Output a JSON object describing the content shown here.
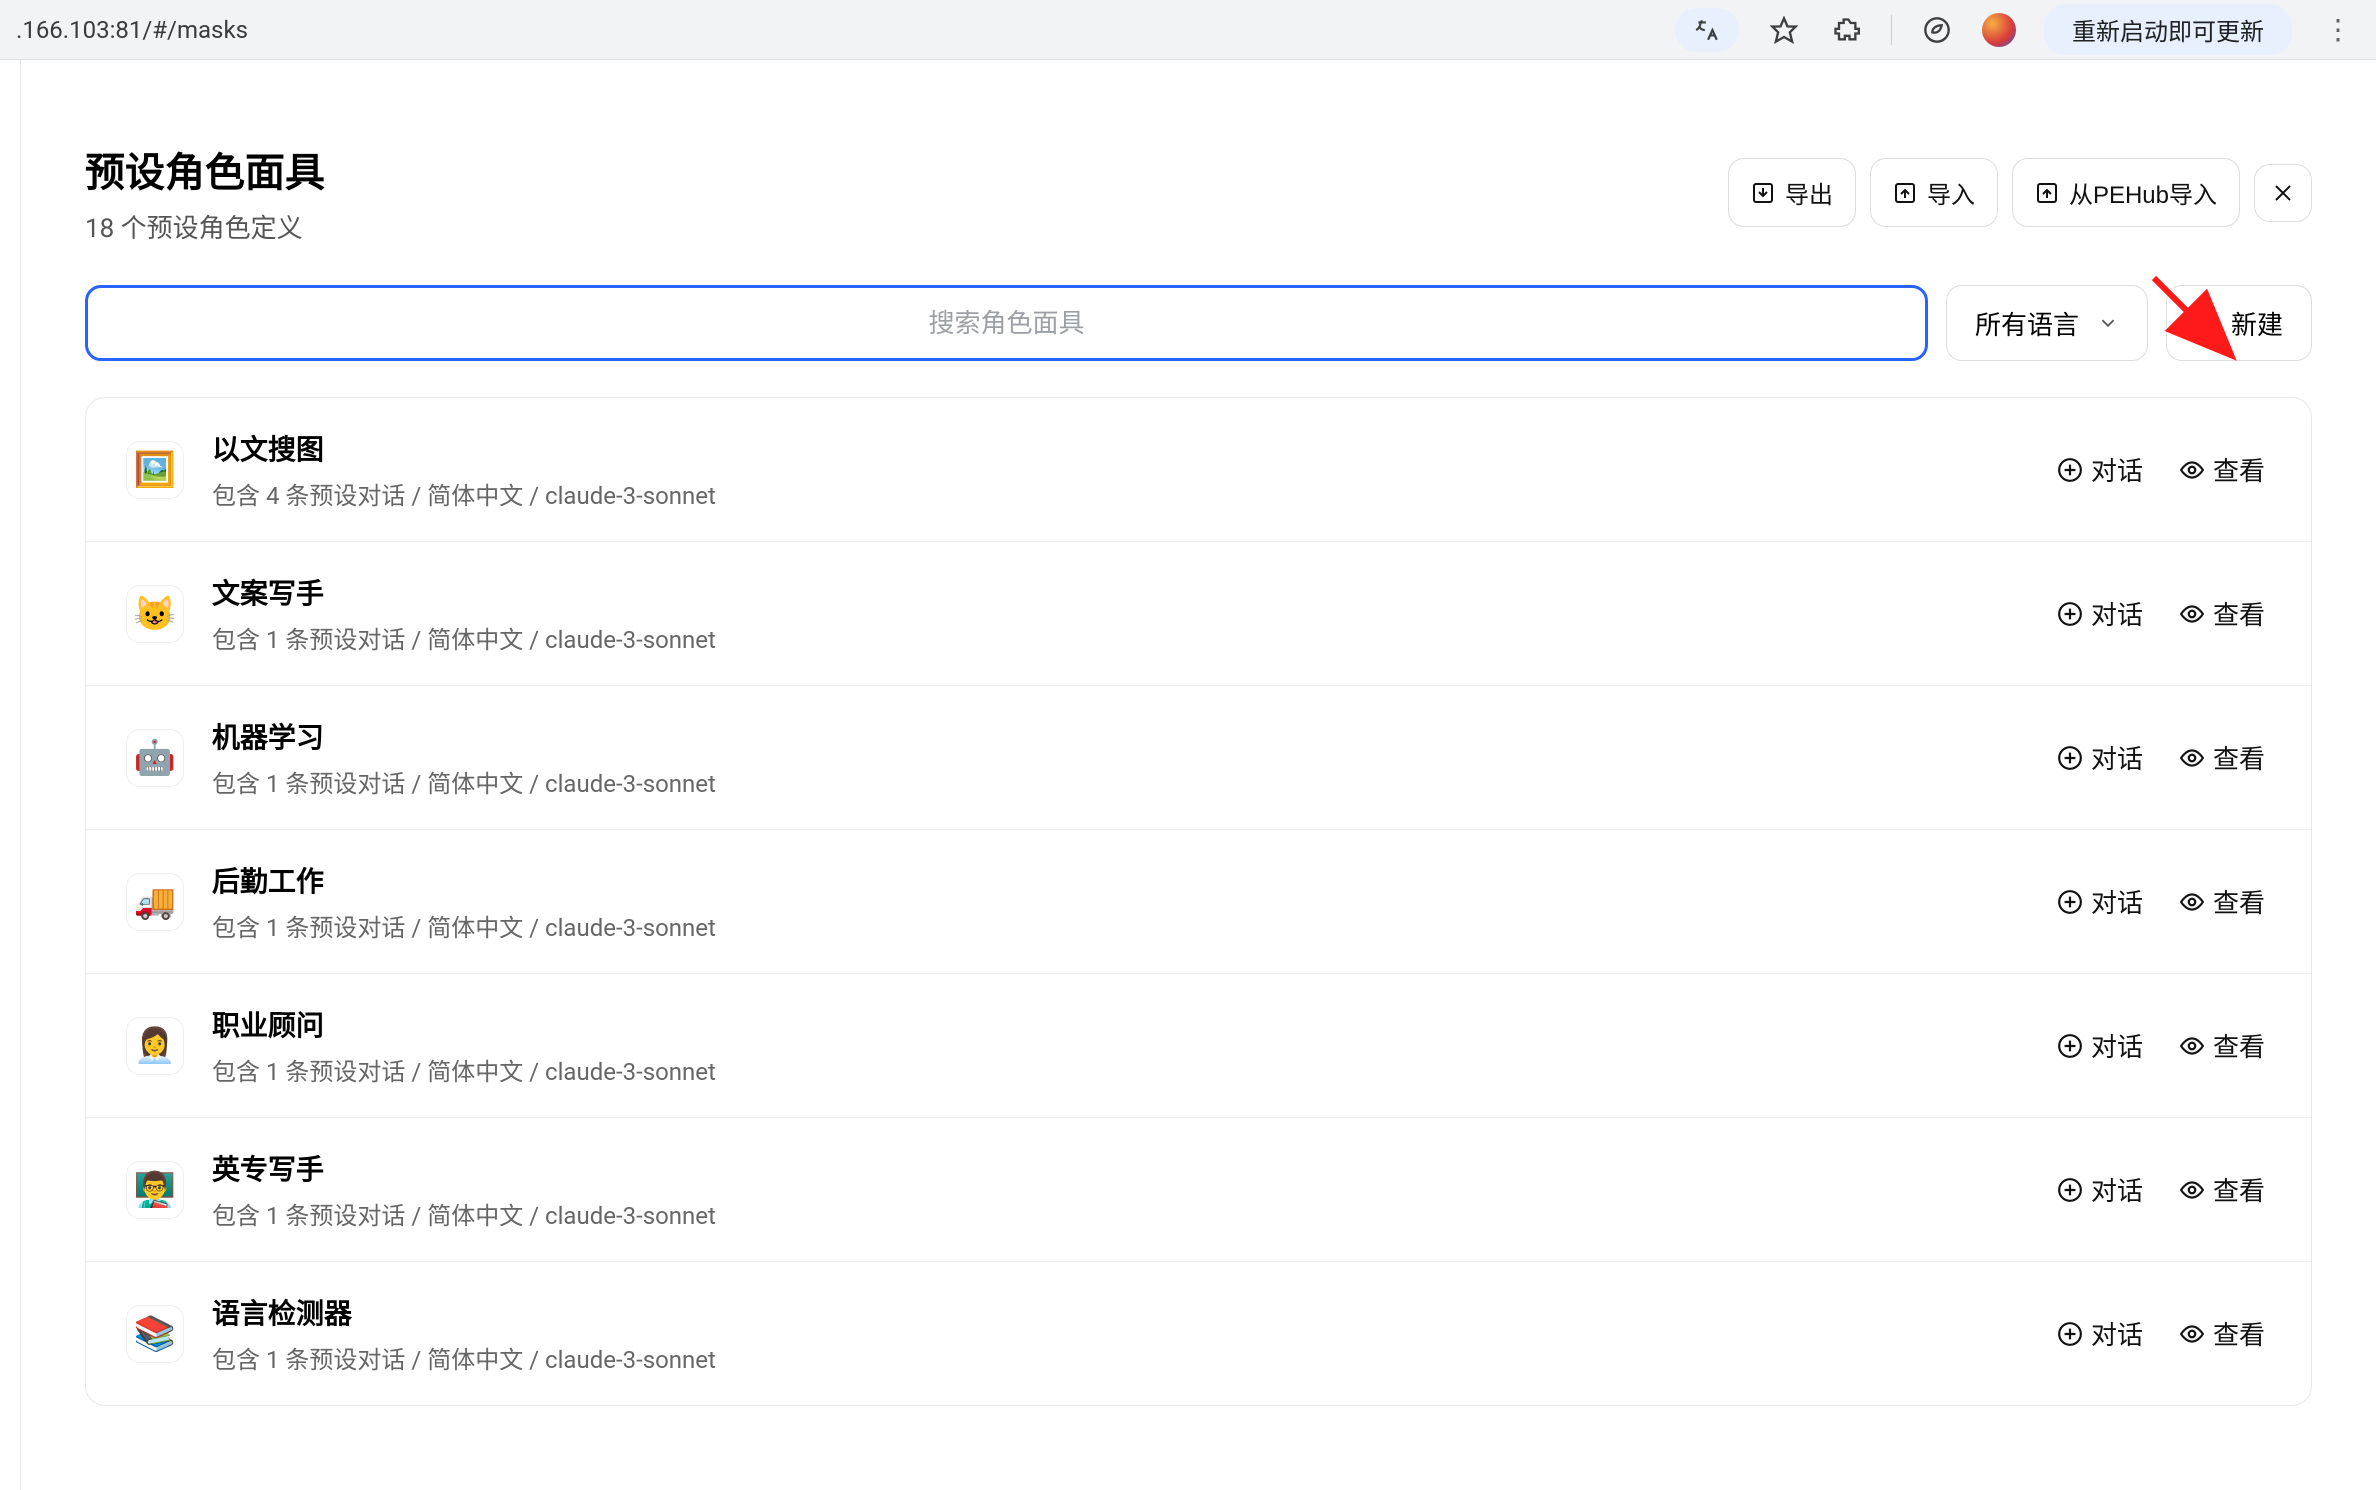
{
  "browser": {
    "url": ".166.103:81/#/masks",
    "update_label": "重新启动即可更新"
  },
  "header": {
    "title": "预设角色面具",
    "subtitle": "18 个预设角色定义",
    "export_label": "导出",
    "import_label": "导入",
    "import_pehub_label": "从PEHub导入"
  },
  "toolbar": {
    "search_placeholder": "搜索角色面具",
    "lang_label": "所有语言",
    "new_label": "新建"
  },
  "row_action": {
    "chat": "对话",
    "view": "查看"
  },
  "masks": [
    {
      "emoji": "🖼️",
      "title": "以文搜图",
      "sub": "包含 4 条预设对话 / 简体中文 / claude-3-sonnet"
    },
    {
      "emoji": "😺",
      "title": "文案写手",
      "sub": "包含 1 条预设对话 / 简体中文 / claude-3-sonnet"
    },
    {
      "emoji": "🤖",
      "title": "机器学习",
      "sub": "包含 1 条预设对话 / 简体中文 / claude-3-sonnet"
    },
    {
      "emoji": "🚚",
      "title": "后勤工作",
      "sub": "包含 1 条预设对话 / 简体中文 / claude-3-sonnet"
    },
    {
      "emoji": "👩‍💼",
      "title": "职业顾问",
      "sub": "包含 1 条预设对话 / 简体中文 / claude-3-sonnet"
    },
    {
      "emoji": "👨‍🏫",
      "title": "英专写手",
      "sub": "包含 1 条预设对话 / 简体中文 / claude-3-sonnet"
    },
    {
      "emoji": "📚",
      "title": "语言检测器",
      "sub": "包含 1 条预设对话 / 简体中文 / claude-3-sonnet"
    }
  ]
}
